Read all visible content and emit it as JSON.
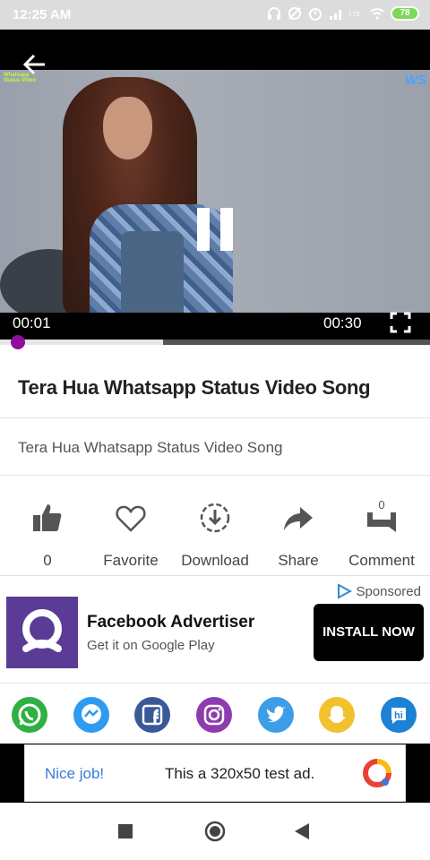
{
  "status_bar": {
    "time": "12:25 AM",
    "battery": "78"
  },
  "player": {
    "watermark_left": "Whatsapp Status Video",
    "watermark_right": "WS",
    "current_time": "00:01",
    "total_time": "00:30",
    "progress_fraction": 0.033,
    "buffered_fraction": 0.38
  },
  "video": {
    "title": "Tera Hua Whatsapp Status Video Song",
    "description": "Tera Hua Whatsapp Status Video Song"
  },
  "actions": [
    {
      "label": "0",
      "icon": "thumbs-up-icon"
    },
    {
      "label": "Favorite",
      "icon": "heart-icon"
    },
    {
      "label": "Download",
      "icon": "download-icon"
    },
    {
      "label": "Share",
      "icon": "share-arrow-icon"
    },
    {
      "label": "Comment",
      "icon": "comment-icon",
      "badge": "0"
    }
  ],
  "ad": {
    "sponsored_label": "Sponsored",
    "advertiser": "Facebook Advertiser",
    "subtitle": "Get it on Google Play",
    "install_label": "INSTALL NOW"
  },
  "share_apps": [
    {
      "icon": "whatsapp-icon",
      "color": "#2fb043"
    },
    {
      "icon": "messenger-icon",
      "color": "#2e9bf0"
    },
    {
      "icon": "facebook-icon",
      "color": "#3b5998"
    },
    {
      "icon": "instagram-icon",
      "color": "#8e3bb0"
    },
    {
      "icon": "twitter-icon",
      "color": "#3c9ee8"
    },
    {
      "icon": "snapchat-icon",
      "color": "#f2c12e"
    },
    {
      "icon": "hike-icon",
      "color": "#1b82d6"
    }
  ],
  "test_ad": {
    "nice": "Nice job!",
    "text": "This a 320x50 test ad."
  },
  "colors": {
    "accent": "#8e0f9e",
    "install_bg": "#000000",
    "ad_logo_bg": "#5a3c96"
  }
}
